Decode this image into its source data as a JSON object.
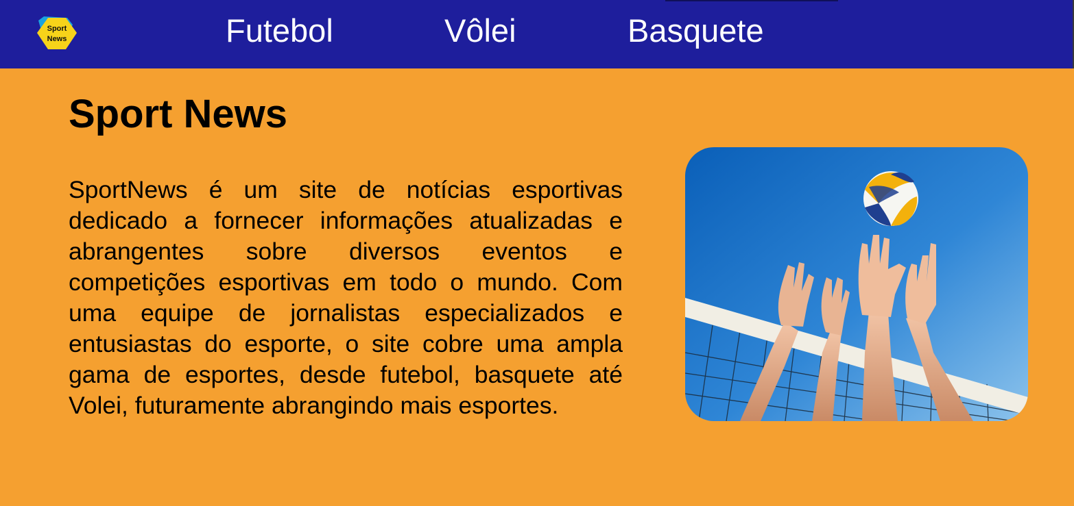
{
  "header": {
    "logo": {
      "icon": "sport-news-logo",
      "text_line1": "Sport",
      "text_line2": "News"
    },
    "nav": [
      {
        "label": "Futebol"
      },
      {
        "label": "Vôlei"
      },
      {
        "label": "Basquete"
      }
    ]
  },
  "main": {
    "title": "Sport News",
    "description": "SportNews é um site de notícias esportivas dedicado a fornecer informações atualizadas e abrangentes sobre diversos eventos e competições esportivas em todo o mundo. Com uma equipe de jornalistas especializados e entusiastas do esporte, o site cobre uma ampla gama de esportes, desde futebol, basquete até Volei, futuramente abrangindo mais esportes.",
    "image": {
      "icon": "volleyball-photo"
    }
  },
  "colors": {
    "navbar": "#1e1e9c",
    "background": "#f5a030",
    "logo_yellow": "#f7d31a",
    "logo_blue": "#1aa3e0"
  }
}
